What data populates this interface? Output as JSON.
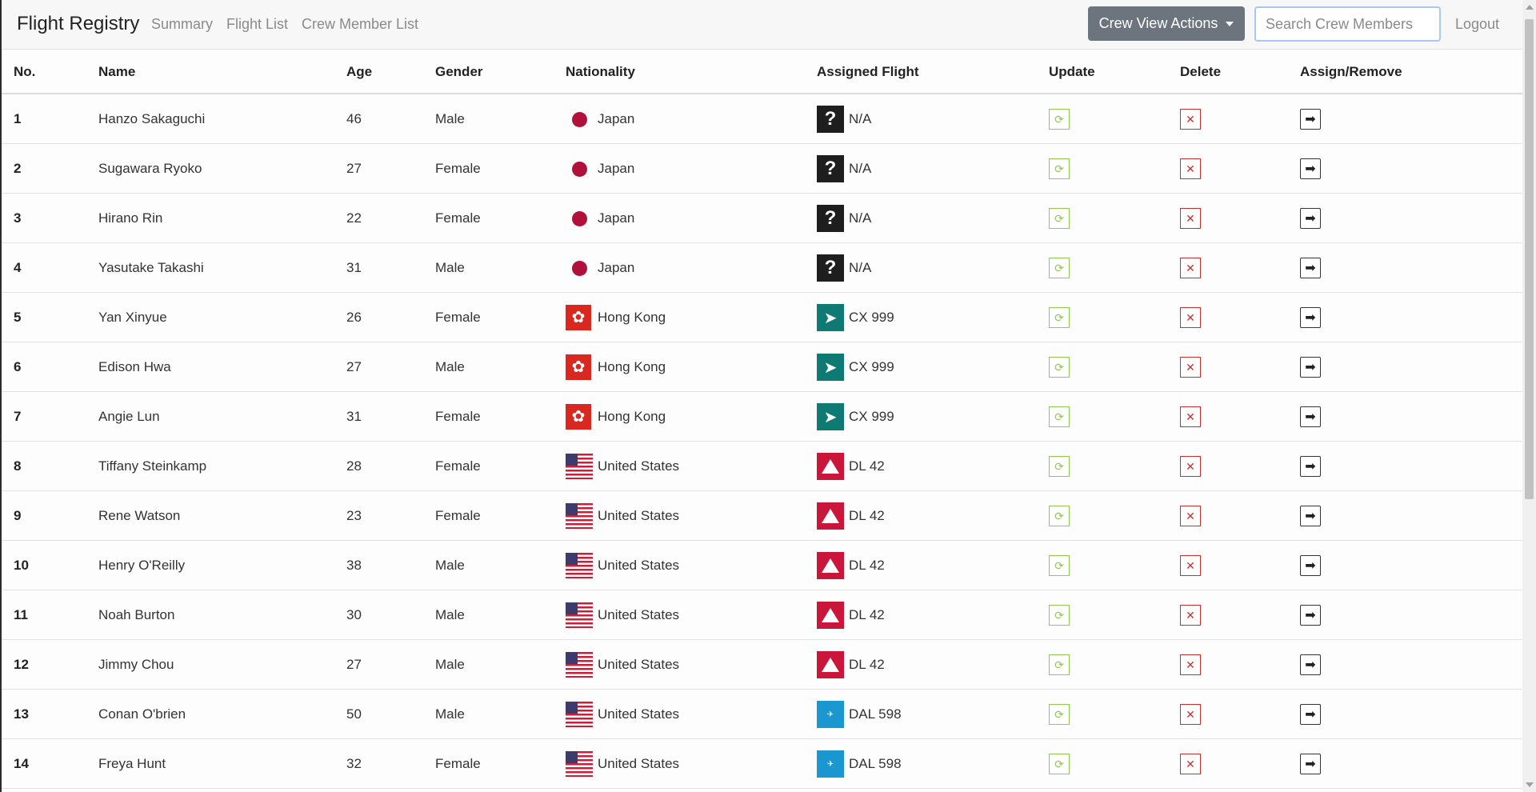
{
  "navbar": {
    "brand": "Flight Registry",
    "links": [
      "Summary",
      "Flight List",
      "Crew Member List"
    ],
    "actions_label": "Crew View Actions",
    "search_placeholder": "Search Crew Members",
    "logout": "Logout"
  },
  "table": {
    "headers": [
      "No.",
      "Name",
      "Age",
      "Gender",
      "Nationality",
      "Assigned Flight",
      "Update",
      "Delete",
      "Assign/Remove"
    ],
    "rows": [
      {
        "no": "1",
        "name": "Hanzo Sakaguchi",
        "age": "46",
        "gender": "Male",
        "nationality": "Japan",
        "flag": "japan-flag",
        "flight": "N/A",
        "airline_logo": "unknown-airline-logo"
      },
      {
        "no": "2",
        "name": "Sugawara Ryoko",
        "age": "27",
        "gender": "Female",
        "nationality": "Japan",
        "flag": "japan-flag",
        "flight": "N/A",
        "airline_logo": "unknown-airline-logo"
      },
      {
        "no": "3",
        "name": "Hirano Rin",
        "age": "22",
        "gender": "Female",
        "nationality": "Japan",
        "flag": "japan-flag",
        "flight": "N/A",
        "airline_logo": "unknown-airline-logo"
      },
      {
        "no": "4",
        "name": "Yasutake Takashi",
        "age": "31",
        "gender": "Male",
        "nationality": "Japan",
        "flag": "japan-flag",
        "flight": "N/A",
        "airline_logo": "unknown-airline-logo"
      },
      {
        "no": "5",
        "name": "Yan Xinyue",
        "age": "26",
        "gender": "Female",
        "nationality": "Hong Kong",
        "flag": "hong-kong-flag",
        "flight": "CX 999",
        "airline_logo": "cathay-logo"
      },
      {
        "no": "6",
        "name": "Edison Hwa",
        "age": "27",
        "gender": "Male",
        "nationality": "Hong Kong",
        "flag": "hong-kong-flag",
        "flight": "CX 999",
        "airline_logo": "cathay-logo"
      },
      {
        "no": "7",
        "name": "Angie Lun",
        "age": "31",
        "gender": "Female",
        "nationality": "Hong Kong",
        "flag": "hong-kong-flag",
        "flight": "CX 999",
        "airline_logo": "cathay-logo"
      },
      {
        "no": "8",
        "name": "Tiffany Steinkamp",
        "age": "28",
        "gender": "Female",
        "nationality": "United States",
        "flag": "us-flag",
        "flight": "DL 42",
        "airline_logo": "delta-logo"
      },
      {
        "no": "9",
        "name": "Rene Watson",
        "age": "23",
        "gender": "Female",
        "nationality": "United States",
        "flag": "us-flag",
        "flight": "DL 42",
        "airline_logo": "delta-logo"
      },
      {
        "no": "10",
        "name": "Henry O'Reilly",
        "age": "38",
        "gender": "Male",
        "nationality": "United States",
        "flag": "us-flag",
        "flight": "DL 42",
        "airline_logo": "delta-logo"
      },
      {
        "no": "11",
        "name": "Noah Burton",
        "age": "30",
        "gender": "Male",
        "nationality": "United States",
        "flag": "us-flag",
        "flight": "DL 42",
        "airline_logo": "delta-logo"
      },
      {
        "no": "12",
        "name": "Jimmy Chou",
        "age": "27",
        "gender": "Male",
        "nationality": "United States",
        "flag": "us-flag",
        "flight": "DL 42",
        "airline_logo": "delta-logo"
      },
      {
        "no": "13",
        "name": "Conan O'brien",
        "age": "50",
        "gender": "Male",
        "nationality": "United States",
        "flag": "us-flag",
        "flight": "DAL 598",
        "airline_logo": "dal-logo"
      },
      {
        "no": "14",
        "name": "Freya Hunt",
        "age": "32",
        "gender": "Female",
        "nationality": "United States",
        "flag": "us-flag",
        "flight": "DAL 598",
        "airline_logo": "dal-logo"
      }
    ]
  },
  "colors": {
    "update_green": "#8fc74f",
    "delete_red": "#c9302c",
    "actions_gray": "#6c757d"
  }
}
